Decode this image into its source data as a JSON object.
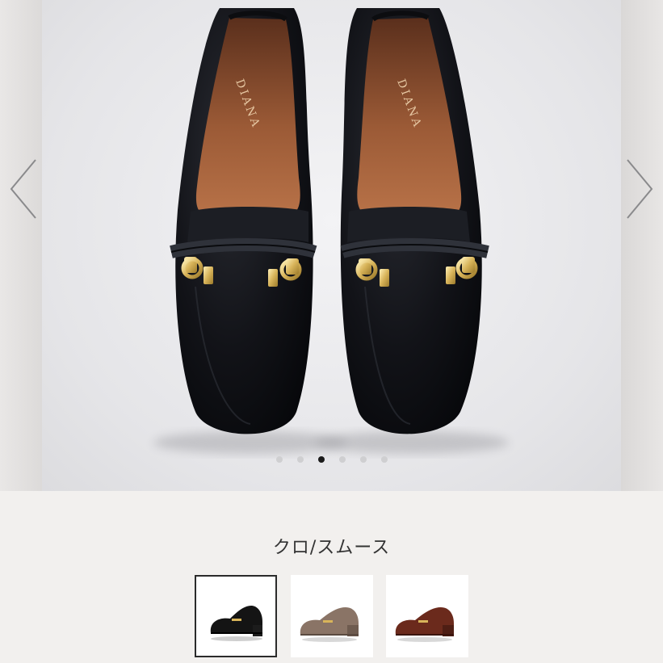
{
  "gallery": {
    "brand_text": "DIANA",
    "current_slide": 3,
    "slide_count": 6,
    "prev_label": "‹",
    "next_label": "›"
  },
  "color": {
    "name": "クロ/スムース",
    "accent": "#1a1a1a"
  },
  "swatches": [
    {
      "color_name": "black",
      "hex": "#141414",
      "selected": true
    },
    {
      "color_name": "taupe",
      "hex": "#8a7466",
      "selected": false
    },
    {
      "color_name": "brown",
      "hex": "#6b2a1c",
      "selected": false
    }
  ]
}
